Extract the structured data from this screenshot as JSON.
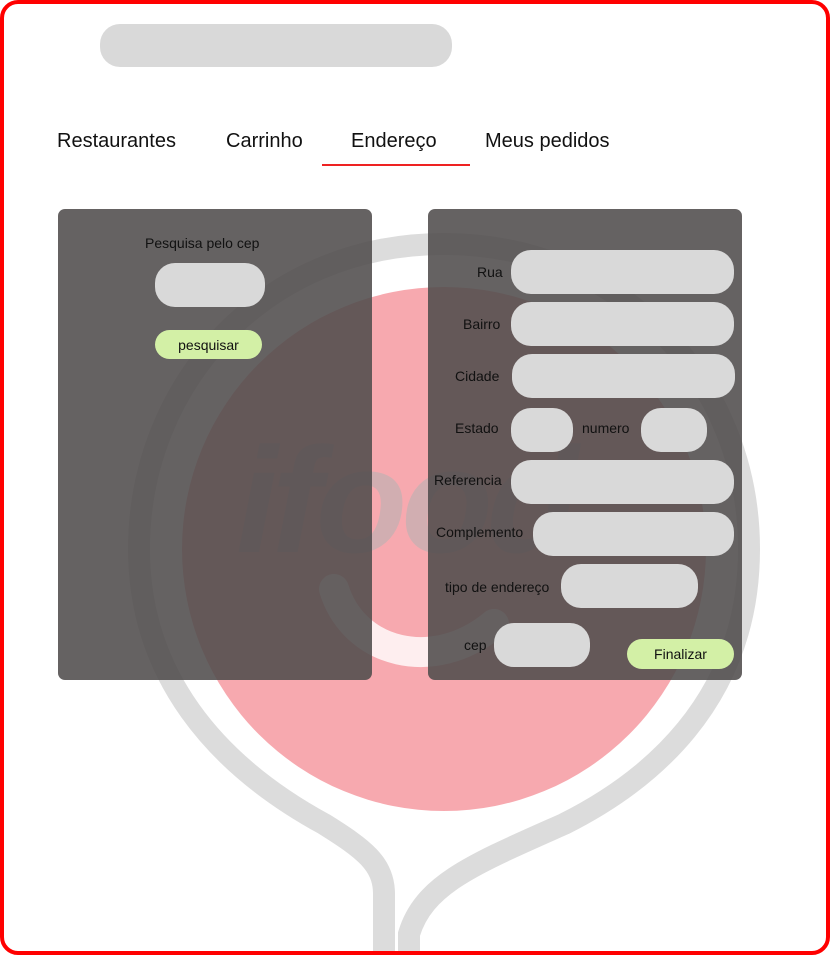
{
  "header": {
    "search": {
      "value": "",
      "placeholder": ""
    }
  },
  "nav": {
    "tabs": [
      {
        "label": "Restaurantes"
      },
      {
        "label": "Carrinho"
      },
      {
        "label": "Endereço"
      },
      {
        "label": "Meus pedidos"
      }
    ],
    "active_tab": "Endereço"
  },
  "background_logo": {
    "text": "ifood",
    "accent_color": "#ea1d2c"
  },
  "cep_search": {
    "label": "Pesquisa pelo cep",
    "input_value": "",
    "button_label": "pesquisar"
  },
  "address_form": {
    "rua_label": "Rua",
    "bairro_label": "Bairro",
    "cidade_label": "Cidade",
    "estado_label": "Estado",
    "numero_label": "numero",
    "referencia_label": "Referencia",
    "complemento_label": "Complemento",
    "tipo_label": "tipo de endereço",
    "cep_label": "cep",
    "submit_label": "Finalizar"
  },
  "colors": {
    "frame_border": "#ff0000",
    "tab_active_underline": "#ee2222",
    "panel_bg": "#504c4c",
    "field_bg": "#d9d9d9",
    "button_bg": "#d3f0a6"
  }
}
